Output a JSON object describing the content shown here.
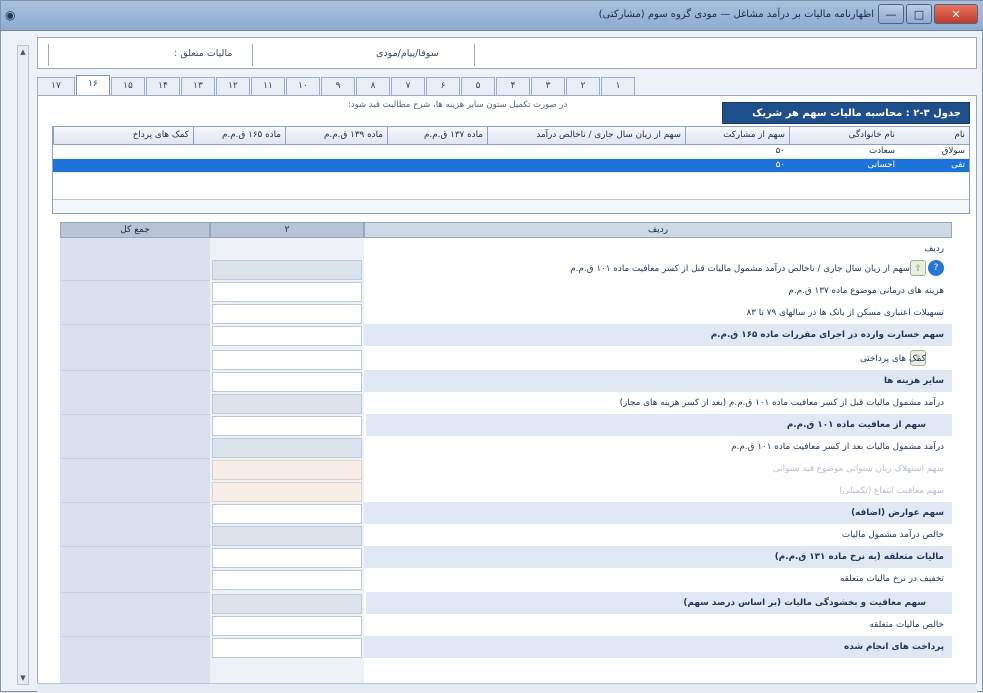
{
  "window": {
    "title": "اظهارنامه مالیات بر درآمد مشاغل — مودی گروه سوم (مشارکتی)",
    "min": "—",
    "max": "□",
    "close": "✕"
  },
  "top": {
    "income_label": "مالیات متعلق :",
    "company_label": "سوفا/پیام/مودی"
  },
  "tabs": [
    "۱",
    "۲",
    "۳",
    "۴",
    "۵",
    "۶",
    "۷",
    "۸",
    "۹",
    "۱۰",
    "۱۱",
    "۱۲",
    "۱۳",
    "۱۴",
    "۱۵",
    "۱۶",
    "۱۷"
  ],
  "hint": "در صورت تکمیل ستون سایر هزینه ها، شرح مطالبت قید شود:",
  "heading": "جدول ۳-۲ : محاسبه مالیات سهم هر شریک",
  "grid": {
    "headers": [
      "نام",
      "نام خانوادگی",
      "سهم از مشارکت",
      "سهم از زیان سال جاری / ناخالص درآمد",
      "ماده ۱۳۷ ق.م.م",
      "ماده ۱۳۹ ق.م.م",
      "ماده ۱۶۵ ق.م.م",
      "کمک های پرداخ"
    ],
    "rows": [
      {
        "name": "سولاق",
        "family": "سعادت",
        "share": "۵۰",
        "sel": false
      },
      {
        "name": "تقی",
        "family": "احسانی",
        "share": "۵۰",
        "sel": true
      }
    ]
  },
  "lower": {
    "headers": {
      "label_col": "ردیف",
      "col2": "۲",
      "total": "جمع کل"
    },
    "rows": [
      {
        "text": "ردیف",
        "type": "section"
      },
      {
        "text": "سهم از زیان سال جاری / ناخالص درآمد مشمول مالیات قبل از کسر معافیت ماده ۱۰۱ ق.م.م",
        "type": "normal"
      },
      {
        "text": "هزینه های درمانی موضوع ماده ۱۳۷ ق.م.م",
        "type": "normal"
      },
      {
        "text": "تسهیلات اعتباری مسکن از بانک ها در سالهای ۷۹ تا ۸۳",
        "type": "normal"
      },
      {
        "text": "سهم خسارت وارده در اجرای مقررات ماده ۱۶۵ ق.م.م",
        "type": "normal"
      },
      {
        "text": "کمک های پرداختی",
        "type": "normal"
      },
      {
        "text": "سایر هزینه ها",
        "type": "normal"
      },
      {
        "text": "درآمد مشمول مالیات قبل از کسر معافیت ماده ۱۰۱ ق.م.م (بعد از کسر هزینه های مجاز)",
        "type": "normal"
      },
      {
        "text": "سهم از معافیت ماده ۱۰۱ ق.م.م",
        "type": "normal"
      },
      {
        "text": "درآمد مشمول مالیات بعد از کسر معافیت ماده ۱۰۱ ق.م.م",
        "type": "normal"
      },
      {
        "text": "سهم استهلاک زیان سنواتی موضوع قید سنواتی",
        "type": "dim"
      },
      {
        "text": "سهم معافیت انتفاع (تکمیلی)",
        "type": "dim"
      },
      {
        "text": "سهم عوارض (اضافه)",
        "type": "normal"
      },
      {
        "text": "خالص درآمد مشمول مالیات",
        "type": "normal"
      },
      {
        "text": "مالیات متعلقه (به نرخ ماده ۱۳۱ ق.م.م)",
        "type": "normal"
      },
      {
        "text": "تخفیف در نرخ مالیات متعلقه",
        "type": "normal"
      },
      {
        "text": "سهم معافیت و بخشودگی مالیات (بر اساس درصد سهم)",
        "type": "normal"
      },
      {
        "text": "خالص مالیات متعلقه",
        "type": "normal"
      },
      {
        "text": "پرداخت های انجام شده",
        "type": "normal"
      }
    ]
  },
  "colors": {
    "accent": "#1f4f8b",
    "selected": "#1e73d8"
  }
}
